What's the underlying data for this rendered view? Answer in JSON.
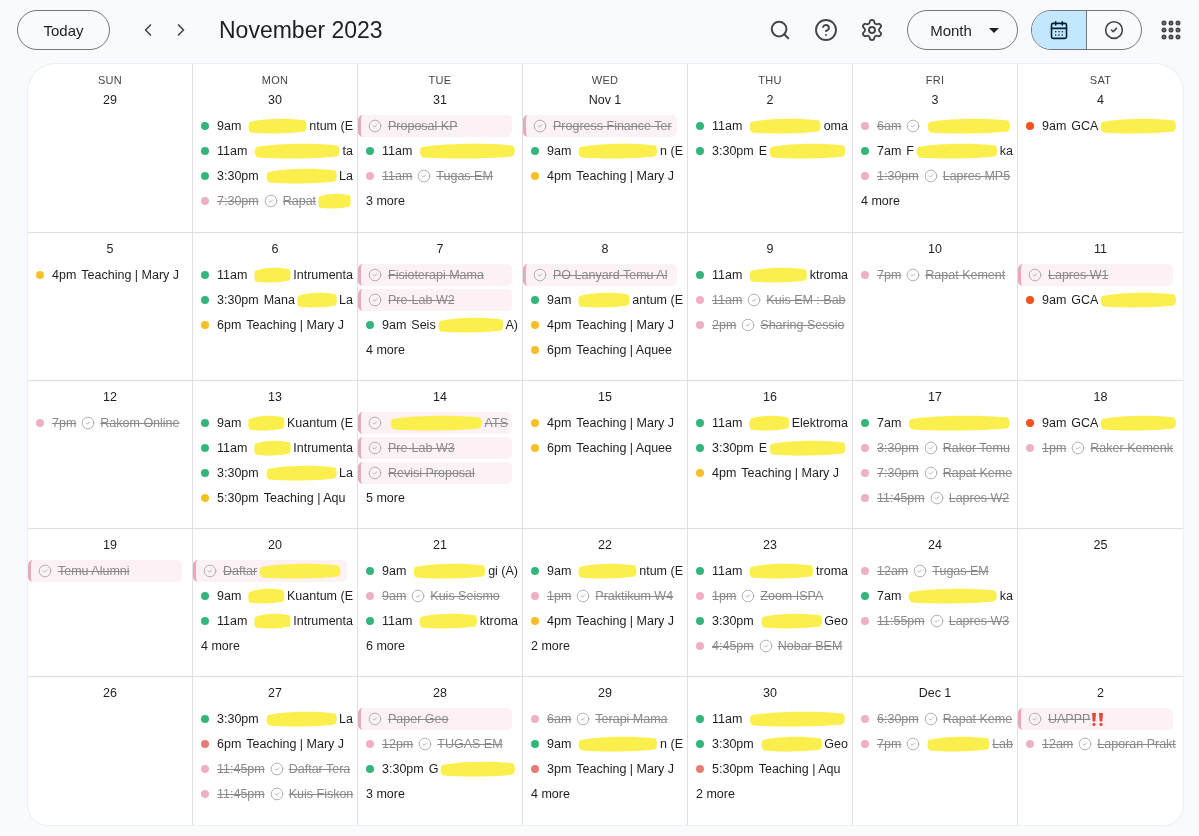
{
  "toolbar": {
    "today": "Today",
    "title": "November 2023",
    "view_menu": "Month"
  },
  "view_toggle": [
    {
      "kind": "calendar",
      "selected": true
    },
    {
      "kind": "tasks",
      "selected": false
    }
  ],
  "weekdays": [
    "SUN",
    "MON",
    "TUE",
    "WED",
    "THU",
    "FRI",
    "SAT"
  ],
  "weeks": [
    [
      {
        "date": "29"
      },
      {
        "date": "30",
        "events": [
          {
            "kind": "event",
            "color": "#33b679",
            "time": "9am",
            "redacted": true,
            "title_end": "ntum (E",
            "done": false
          },
          {
            "kind": "event",
            "color": "#33b679",
            "time": "11am",
            "redacted": true,
            "title_end": "ta",
            "done": false
          },
          {
            "kind": "event",
            "color": "#33b679",
            "time": "3:30pm",
            "redacted": true,
            "title_end": "La",
            "done": false
          },
          {
            "kind": "task",
            "color": "#eeb0c2",
            "time": "7:30pm",
            "title": "Rapat",
            "redacted": true,
            "done": true
          }
        ]
      },
      {
        "date": "31",
        "events": [
          {
            "kind": "chip",
            "title": "Proposal KP",
            "done": true
          },
          {
            "kind": "event",
            "color": "#33b679",
            "time": "11am",
            "redacted": true,
            "done": false
          },
          {
            "kind": "task",
            "color": "#eeb0c2",
            "time": "11am",
            "title": "Tugas EM",
            "done": true
          }
        ],
        "more": "3 more"
      },
      {
        "date": "Nov 1",
        "events": [
          {
            "kind": "chip",
            "title": "Progress Finance Ter",
            "done": true
          },
          {
            "kind": "event",
            "color": "#33b679",
            "time": "9am",
            "redacted": true,
            "title_end": "n (E",
            "done": false
          },
          {
            "kind": "event",
            "color": "#f6bf26",
            "time": "4pm",
            "title": "Teaching | Mary J",
            "done": false
          }
        ]
      },
      {
        "date": "2",
        "events": [
          {
            "kind": "event",
            "color": "#33b679",
            "time": "11am",
            "redacted": true,
            "title_end": "oma",
            "done": false
          },
          {
            "kind": "event",
            "color": "#33b679",
            "time": "3:30pm",
            "title": "E",
            "redacted": true,
            "done": false
          }
        ]
      },
      {
        "date": "3",
        "events": [
          {
            "kind": "task",
            "color": "#eeb0c2",
            "time": "6am",
            "redacted": true,
            "done": true
          },
          {
            "kind": "event",
            "color": "#33b679",
            "time": "7am",
            "title": "F",
            "redacted": true,
            "title_end": "ka",
            "done": false
          },
          {
            "kind": "task",
            "color": "#eeb0c2",
            "time": "1:30pm",
            "title": "Lapres MP5",
            "done": true
          }
        ],
        "more": "4 more"
      },
      {
        "date": "4",
        "events": [
          {
            "kind": "event",
            "color": "#f4511e",
            "time": "9am",
            "title": "GCA",
            "redacted": true,
            "done": false
          }
        ]
      }
    ],
    [
      {
        "date": "5",
        "events": [
          {
            "kind": "event",
            "color": "#f6bf26",
            "time": "4pm",
            "title": "Teaching | Mary J",
            "done": false
          }
        ]
      },
      {
        "date": "6",
        "events": [
          {
            "kind": "event",
            "color": "#33b679",
            "time": "11am",
            "redacted": true,
            "title_end": "Intrumenta",
            "done": false
          },
          {
            "kind": "event",
            "color": "#33b679",
            "time": "3:30pm",
            "title": "Mana",
            "redacted": true,
            "title_end": "La",
            "done": false
          },
          {
            "kind": "event",
            "color": "#f6bf26",
            "time": "6pm",
            "title": "Teaching | Mary J",
            "done": false
          }
        ]
      },
      {
        "date": "7",
        "events": [
          {
            "kind": "chip",
            "title": "Fisioterapi Mama",
            "done": true
          },
          {
            "kind": "chip",
            "title": "Pre-Lab W2",
            "done": true
          },
          {
            "kind": "event",
            "color": "#33b679",
            "time": "9am",
            "title": "Seis",
            "redacted": true,
            "title_end": "A)",
            "done": false
          }
        ],
        "more": "4 more"
      },
      {
        "date": "8",
        "events": [
          {
            "kind": "chip",
            "title": "PO Lanyard Temu Al",
            "done": true
          },
          {
            "kind": "event",
            "color": "#33b679",
            "time": "9am",
            "redacted": true,
            "title_end": "antum (E",
            "done": false
          },
          {
            "kind": "event",
            "color": "#f6bf26",
            "time": "4pm",
            "title": "Teaching | Mary J",
            "done": false
          },
          {
            "kind": "event",
            "color": "#f6bf26",
            "time": "6pm",
            "title": "Teaching | Aquee",
            "done": false
          }
        ]
      },
      {
        "date": "9",
        "events": [
          {
            "kind": "event",
            "color": "#33b679",
            "time": "11am",
            "redacted": true,
            "title_end": "ktroma",
            "done": false
          },
          {
            "kind": "task",
            "color": "#eeb0c2",
            "time": "11am",
            "title": "Kuis EM : Bab",
            "done": true
          },
          {
            "kind": "task",
            "color": "#eeb0c2",
            "time": "2pm",
            "title": "Sharing Sessio",
            "done": true
          }
        ]
      },
      {
        "date": "10",
        "events": [
          {
            "kind": "task",
            "color": "#eeb0c2",
            "time": "7pm",
            "title": "Rapat Kement",
            "done": true
          }
        ]
      },
      {
        "date": "11",
        "events": [
          {
            "kind": "chip",
            "title": "Lapres W1",
            "done": true
          },
          {
            "kind": "event",
            "color": "#f4511e",
            "time": "9am",
            "title": "GCA",
            "redacted": true,
            "done": false
          }
        ]
      }
    ],
    [
      {
        "date": "12",
        "events": [
          {
            "kind": "task",
            "color": "#eeb0c2",
            "time": "7pm",
            "title": "Rakom Online",
            "done": true
          }
        ]
      },
      {
        "date": "13",
        "events": [
          {
            "kind": "event",
            "color": "#33b679",
            "time": "9am",
            "redacted": true,
            "title_end": "Kuantum (E",
            "done": false
          },
          {
            "kind": "event",
            "color": "#33b679",
            "time": "11am",
            "redacted": true,
            "title_end": "Intrumenta",
            "done": false
          },
          {
            "kind": "event",
            "color": "#33b679",
            "time": "3:30pm",
            "redacted": true,
            "title_end": "La",
            "done": false
          },
          {
            "kind": "event",
            "color": "#f6bf26",
            "time": "5:30pm",
            "title": "Teaching | Aqu",
            "done": false
          }
        ]
      },
      {
        "date": "14",
        "events": [
          {
            "kind": "chip",
            "redacted": true,
            "title_end": "ATS",
            "done": true
          },
          {
            "kind": "chip",
            "title": "Pre-Lab W3",
            "done": true
          },
          {
            "kind": "chip",
            "title": "Revisi Proposal",
            "done": true
          }
        ],
        "more": "5 more"
      },
      {
        "date": "15",
        "events": [
          {
            "kind": "event",
            "color": "#f6bf26",
            "time": "4pm",
            "title": "Teaching | Mary J",
            "done": false
          },
          {
            "kind": "event",
            "color": "#f6bf26",
            "time": "6pm",
            "title": "Teaching | Aquee",
            "done": false
          }
        ]
      },
      {
        "date": "16",
        "events": [
          {
            "kind": "event",
            "color": "#33b679",
            "time": "11am",
            "redacted": true,
            "title_end": "Elektroma",
            "done": false
          },
          {
            "kind": "event",
            "color": "#33b679",
            "time": "3:30pm",
            "title": "E",
            "redacted": true,
            "done": false
          },
          {
            "kind": "event",
            "color": "#f6bf26",
            "time": "4pm",
            "title": "Teaching | Mary J",
            "done": false
          }
        ]
      },
      {
        "date": "17",
        "events": [
          {
            "kind": "event",
            "color": "#33b679",
            "time": "7am",
            "redacted": true,
            "done": false
          },
          {
            "kind": "task",
            "color": "#eeb0c2",
            "time": "3:30pm",
            "title": "Rakor Temu",
            "done": true
          },
          {
            "kind": "task",
            "color": "#eeb0c2",
            "time": "7:30pm",
            "title": "Rapat Keme",
            "done": true
          },
          {
            "kind": "task",
            "color": "#eeb0c2",
            "time": "11:45pm",
            "title": "Lapres W2",
            "done": true
          }
        ]
      },
      {
        "date": "18",
        "events": [
          {
            "kind": "event",
            "color": "#f4511e",
            "time": "9am",
            "title": "GCA",
            "redacted": true,
            "done": false
          },
          {
            "kind": "task",
            "color": "#eeb0c2",
            "time": "1pm",
            "title": "Raker Kemenk",
            "done": true
          }
        ]
      }
    ],
    [
      {
        "date": "19",
        "events": [
          {
            "kind": "chip",
            "title": "Temu Alumni",
            "done": true
          }
        ]
      },
      {
        "date": "20",
        "events": [
          {
            "kind": "chip",
            "title": "Daftar",
            "redacted": true,
            "done": true
          },
          {
            "kind": "event",
            "color": "#33b679",
            "time": "9am",
            "redacted": true,
            "title_end": "Kuantum (E",
            "done": false
          },
          {
            "kind": "event",
            "color": "#33b679",
            "time": "11am",
            "redacted": true,
            "title_end": "Intrumenta",
            "done": false
          }
        ],
        "more": "4 more"
      },
      {
        "date": "21",
        "events": [
          {
            "kind": "event",
            "color": "#33b679",
            "time": "9am",
            "redacted": true,
            "title_end": "gi (A)",
            "done": false
          },
          {
            "kind": "task",
            "color": "#eeb0c2",
            "time": "9am",
            "title": "Kuis Seismo",
            "done": true
          },
          {
            "kind": "event",
            "color": "#33b679",
            "time": "11am",
            "redacted": true,
            "title_end": "ktroma",
            "done": false
          }
        ],
        "more": "6 more"
      },
      {
        "date": "22",
        "events": [
          {
            "kind": "event",
            "color": "#33b679",
            "time": "9am",
            "redacted": true,
            "title_end": "ntum (E",
            "done": false
          },
          {
            "kind": "task",
            "color": "#eeb0c2",
            "time": "1pm",
            "title": "Praktikum W4",
            "done": true
          },
          {
            "kind": "event",
            "color": "#f6bf26",
            "time": "4pm",
            "title": "Teaching | Mary J",
            "done": false
          }
        ],
        "more": "2 more"
      },
      {
        "date": "23",
        "events": [
          {
            "kind": "event",
            "color": "#33b679",
            "time": "11am",
            "redacted": true,
            "title_end": "troma",
            "done": false
          },
          {
            "kind": "task",
            "color": "#eeb0c2",
            "time": "1pm",
            "title": "Zoom ISPA",
            "done": true
          },
          {
            "kind": "event",
            "color": "#33b679",
            "time": "3:30pm",
            "redacted": true,
            "title_end": "Geo",
            "done": false
          },
          {
            "kind": "task",
            "color": "#eeb0c2",
            "time": "4:45pm",
            "title": "Nobar BEM",
            "done": true
          }
        ]
      },
      {
        "date": "24",
        "events": [
          {
            "kind": "task",
            "color": "#eeb0c2",
            "time": "12am",
            "title": "Tugas EM",
            "done": true
          },
          {
            "kind": "event",
            "color": "#33b679",
            "time": "7am",
            "redacted": true,
            "title_end": "ka",
            "done": false
          },
          {
            "kind": "task",
            "color": "#eeb0c2",
            "time": "11:55pm",
            "title": "Lapres W3",
            "done": true
          }
        ]
      },
      {
        "date": "25"
      }
    ],
    [
      {
        "date": "26"
      },
      {
        "date": "27",
        "events": [
          {
            "kind": "event",
            "color": "#33b679",
            "time": "3:30pm",
            "redacted": true,
            "title_end": "La",
            "done": false
          },
          {
            "kind": "event",
            "color": "#e67c73",
            "time": "6pm",
            "title": "Teaching | Mary J",
            "done": false
          },
          {
            "kind": "task",
            "color": "#eeb0c2",
            "time": "11:45pm",
            "title": "Daftar Tera",
            "done": true
          },
          {
            "kind": "task",
            "color": "#eeb0c2",
            "time": "11:45pm",
            "title": "Kuis Fiskon",
            "done": true
          }
        ]
      },
      {
        "date": "28",
        "events": [
          {
            "kind": "chip",
            "title": "Paper Geo",
            "done": true
          },
          {
            "kind": "task",
            "color": "#eeb0c2",
            "time": "12pm",
            "title": "TUGAS EM",
            "done": true
          },
          {
            "kind": "event",
            "color": "#33b679",
            "time": "3:30pm",
            "title": "G",
            "redacted": true,
            "done": false
          }
        ],
        "more": "3 more"
      },
      {
        "date": "29",
        "events": [
          {
            "kind": "task",
            "color": "#eeb0c2",
            "time": "6am",
            "title": "Terapi Mama",
            "done": true
          },
          {
            "kind": "event",
            "color": "#33b679",
            "time": "9am",
            "redacted": true,
            "title_end": "n (E",
            "done": false
          },
          {
            "kind": "event",
            "color": "#e67c73",
            "time": "3pm",
            "title": "Teaching | Mary J",
            "done": false
          }
        ],
        "more": "4 more"
      },
      {
        "date": "30",
        "events": [
          {
            "kind": "event",
            "color": "#33b679",
            "time": "11am",
            "redacted": true,
            "done": false
          },
          {
            "kind": "event",
            "color": "#33b679",
            "time": "3:30pm",
            "redacted": true,
            "title_end": "Geo",
            "done": false
          },
          {
            "kind": "event",
            "color": "#e67c73",
            "time": "5:30pm",
            "title": "Teaching | Aqu",
            "done": false
          }
        ],
        "more": "2 more"
      },
      {
        "date": "Dec 1",
        "events": [
          {
            "kind": "task",
            "color": "#eeb0c2",
            "time": "6:30pm",
            "title": "Rapat Keme",
            "done": true
          },
          {
            "kind": "task",
            "color": "#eeb0c2",
            "time": "7pm",
            "redacted": true,
            "title_end": "Lab",
            "done": true
          }
        ]
      },
      {
        "date": "2",
        "events": [
          {
            "kind": "chip",
            "title": "UAPPP",
            "urgent": true,
            "done": true
          },
          {
            "kind": "task",
            "color": "#eeb0c2",
            "time": "12am",
            "title": "Laporan Prakt",
            "done": true
          }
        ]
      }
    ]
  ]
}
